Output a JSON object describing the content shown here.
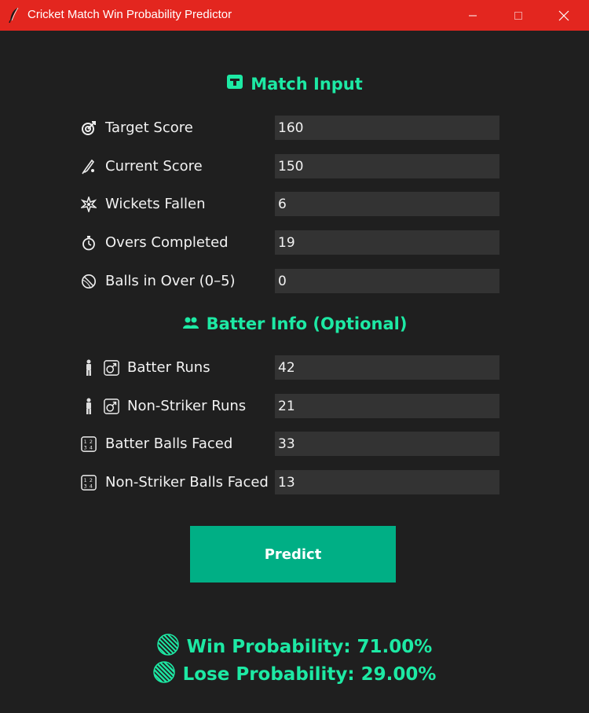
{
  "window": {
    "title": "Cricket Match Win Probability Predictor",
    "accent": "#e3261f"
  },
  "colors": {
    "heading": "#1de9a4",
    "button": "#00af85",
    "field": "#333333",
    "background": "#1f1f1f"
  },
  "match_input": {
    "title": "Match Input",
    "icon": "calendar-icon",
    "fields": [
      {
        "label": "Target Score",
        "value": "160",
        "icon": "target-icon"
      },
      {
        "label": "Current Score",
        "value": "150",
        "icon": "bat-icon"
      },
      {
        "label": "Wickets Fallen",
        "value": "6",
        "icon": "burst-icon"
      },
      {
        "label": "Overs Completed",
        "value": "19",
        "icon": "stopwatch-icon"
      },
      {
        "label": "Balls in Over (0–5)",
        "value": "0",
        "icon": "ball-icon"
      }
    ]
  },
  "batter_info": {
    "title": "Batter Info (Optional)",
    "icon": "people-icon",
    "fields": [
      {
        "label": "Batter Runs",
        "value": "42",
        "icon": "batter-male-icon"
      },
      {
        "label": "Non-Striker Runs",
        "value": "21",
        "icon": "batter-male-icon"
      },
      {
        "label": "Batter Balls Faced",
        "value": "33",
        "icon": "numbers-icon"
      },
      {
        "label": "Non-Striker Balls Faced",
        "value": "13",
        "icon": "numbers-icon"
      }
    ]
  },
  "predict": {
    "label": "Predict"
  },
  "results": {
    "win": "Win Probability: 71.00%",
    "lose": "Lose Probability: 29.00%"
  }
}
